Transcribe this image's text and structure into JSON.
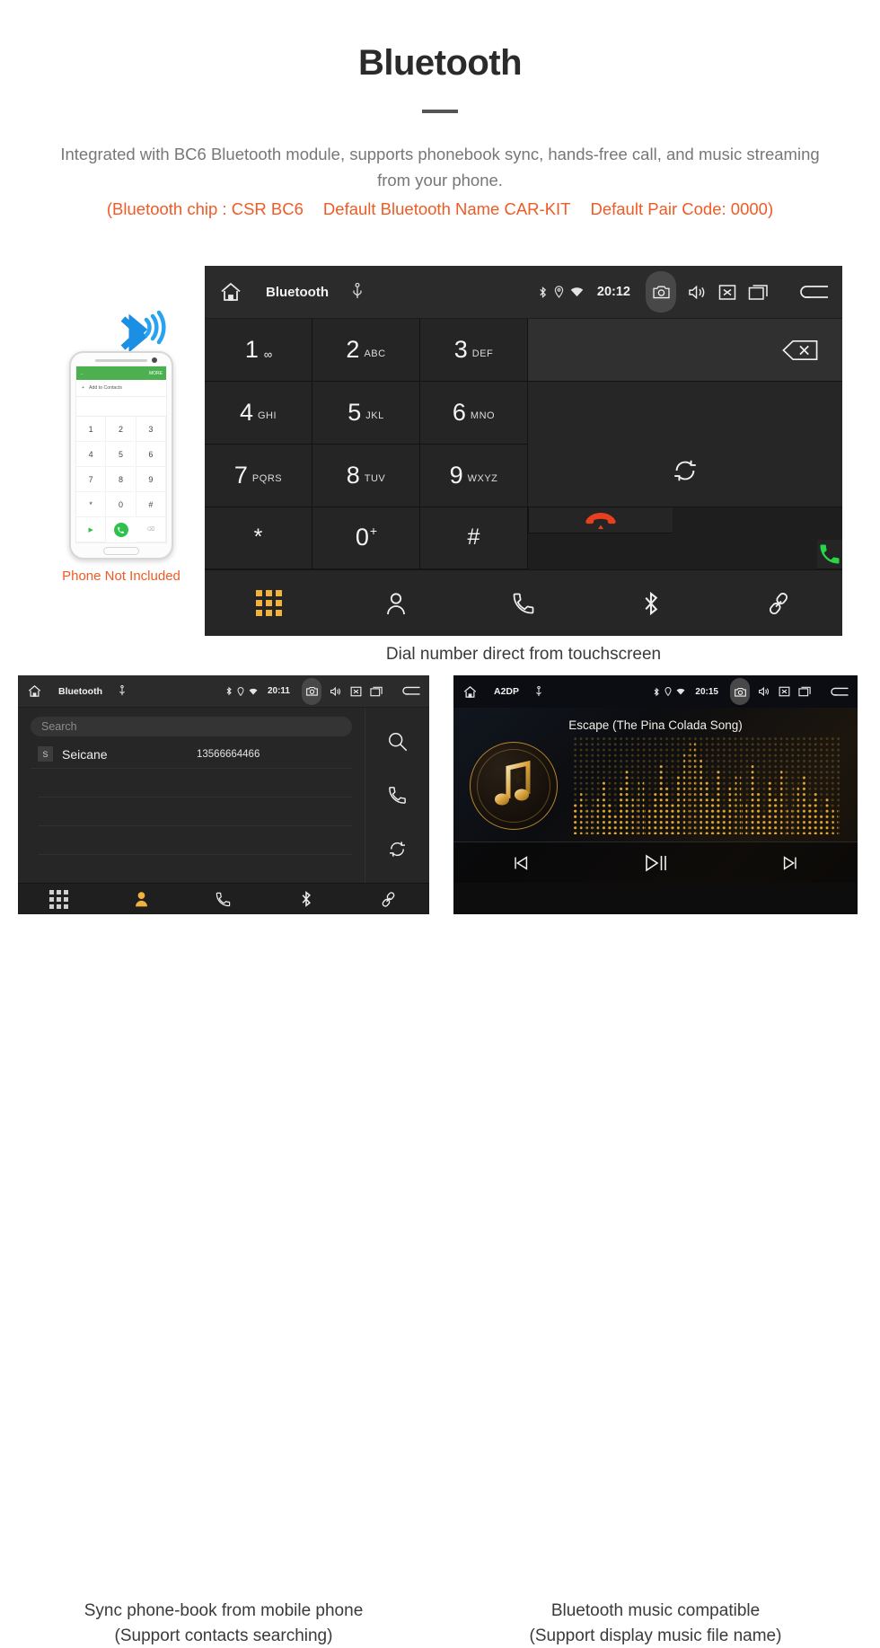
{
  "header": {
    "title": "Bluetooth",
    "subtitle": "Integrated with BC6 Bluetooth module, supports phonebook sync, hands-free call, and music streaming from your phone.",
    "specs": [
      "(Bluetooth chip : CSR BC6",
      "Default Bluetooth Name CAR-KIT",
      "Default Pair Code: 0000)"
    ],
    "accent_color": "#ef5b25",
    "subtitle_color": "#777777"
  },
  "dialer_screen": {
    "statusbar": {
      "title": "Bluetooth",
      "clock": "20:12",
      "icons": [
        "home-icon",
        "usb-icon",
        "bluetooth-icon",
        "location-icon",
        "wifi-icon",
        "camera-icon",
        "volume-icon",
        "close-box-icon",
        "recent-apps-icon",
        "back-icon"
      ]
    },
    "keys": [
      {
        "num": "1",
        "sub": "",
        "vm": "∞"
      },
      {
        "num": "2",
        "sub": "ABC"
      },
      {
        "num": "3",
        "sub": "DEF"
      },
      {
        "num": "4",
        "sub": "GHI"
      },
      {
        "num": "5",
        "sub": "JKL"
      },
      {
        "num": "6",
        "sub": "MNO"
      },
      {
        "num": "7",
        "sub": "PQRS"
      },
      {
        "num": "8",
        "sub": "TUV"
      },
      {
        "num": "9",
        "sub": "WXYZ"
      },
      {
        "num": "*",
        "sub": ""
      },
      {
        "num": "0",
        "sub": "",
        "plus": "+"
      },
      {
        "num": "#",
        "sub": ""
      }
    ],
    "display_value": "",
    "nav": [
      {
        "name": "dialpad",
        "icon": "dialpad-icon",
        "active": true
      },
      {
        "name": "contacts",
        "icon": "person-icon",
        "active": false
      },
      {
        "name": "call-log",
        "icon": "phone-icon",
        "active": false
      },
      {
        "name": "bluetooth",
        "icon": "bluetooth-icon",
        "active": false
      },
      {
        "name": "link",
        "icon": "link-icon",
        "active": false
      }
    ],
    "colors": {
      "call": "#2ecc40",
      "end": "#e8401f",
      "active_nav": "#f2b23e"
    }
  },
  "phone_mock": {
    "header_back": "←",
    "header_more": "MORE",
    "add_contact": "Add to Contacts",
    "keys": [
      "1",
      "2",
      "3",
      "4",
      "5",
      "6",
      "7",
      "8",
      "9",
      "*",
      "0",
      "#"
    ],
    "caption": "Phone Not Included"
  },
  "captions": {
    "hero": "Dial number direct from touchscreen",
    "contacts_line1": "Sync phone-book from mobile phone",
    "contacts_line2": "(Support contacts searching)",
    "music_line1": "Bluetooth music compatible",
    "music_line2": "(Support display music file name)"
  },
  "contacts_screen": {
    "statusbar": {
      "title": "Bluetooth",
      "clock": "20:11"
    },
    "search_placeholder": "Search",
    "contact": {
      "initial": "S",
      "name": "Seicane",
      "number": "13566664466"
    },
    "side_icons": [
      "search-icon",
      "phone-icon",
      "sync-icon"
    ],
    "nav": [
      {
        "name": "dialpad",
        "icon": "dialpad-icon",
        "active": false
      },
      {
        "name": "contacts",
        "icon": "person-icon",
        "active": true
      },
      {
        "name": "call-log",
        "icon": "phone-icon",
        "active": false
      },
      {
        "name": "bluetooth",
        "icon": "bluetooth-icon",
        "active": false
      },
      {
        "name": "link",
        "icon": "link-icon",
        "active": false
      }
    ]
  },
  "music_screen": {
    "statusbar": {
      "title": "A2DP",
      "clock": "20:15"
    },
    "song_title": "Escape (The Pina Colada Song)",
    "controls": [
      "previous-track-icon",
      "play-pause-icon",
      "next-track-icon"
    ],
    "accent_color": "#d8a13c"
  }
}
